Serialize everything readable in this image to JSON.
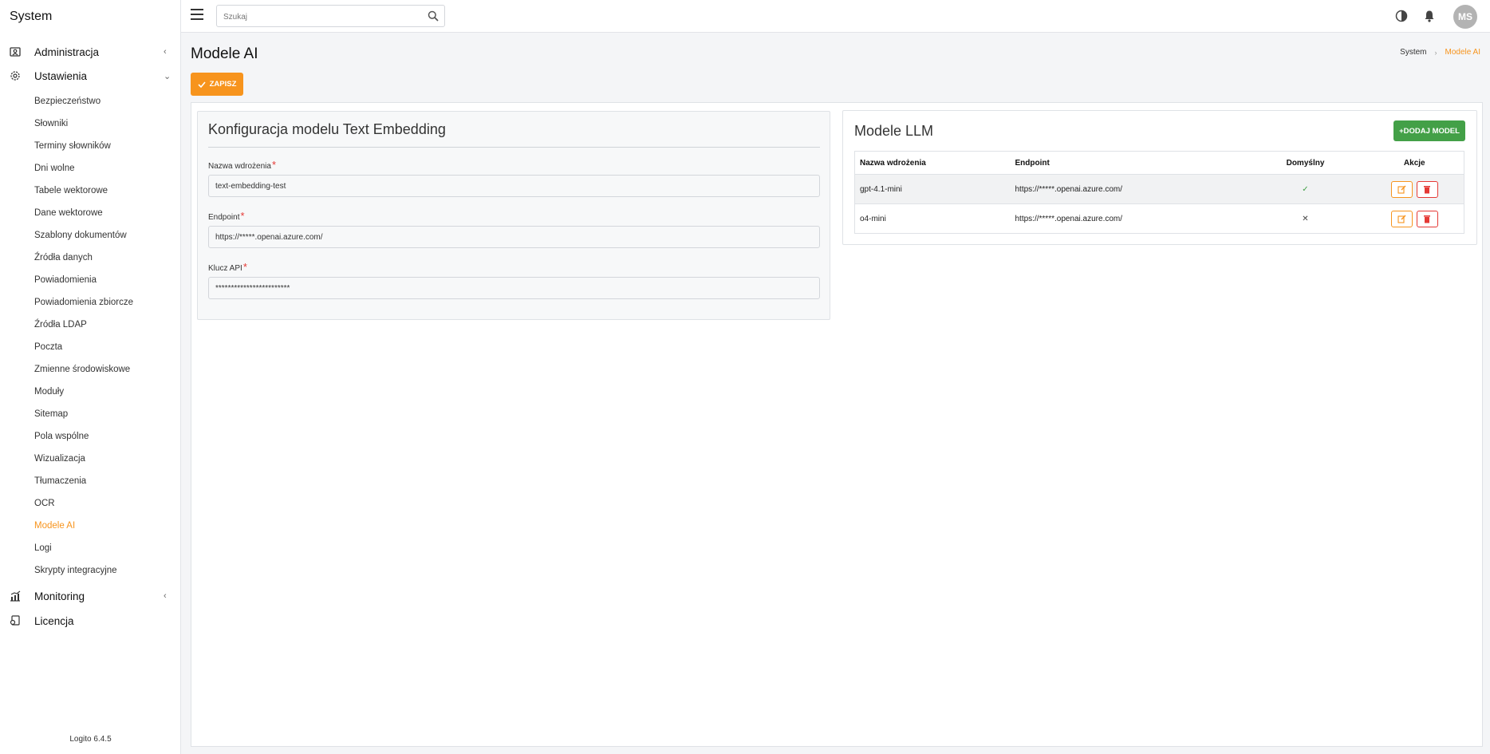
{
  "sidebar": {
    "brand": "System",
    "groups": {
      "administracja": "Administracja",
      "ustawienia": "Ustawienia",
      "monitoring": "Monitoring",
      "licencja": "Licencja"
    },
    "items": [
      "Bezpieczeństwo",
      "Słowniki",
      "Terminy słowników",
      "Dni wolne",
      "Tabele wektorowe",
      "Dane wektorowe",
      "Szablony dokumentów",
      "Źródła danych",
      "Powiadomienia",
      "Powiadomienia zbiorcze",
      "Źródła LDAP",
      "Poczta",
      "Zmienne środowiskowe",
      "Moduły",
      "Sitemap",
      "Pola wspólne",
      "Wizualizacja",
      "Tłumaczenia",
      "OCR",
      "Modele AI",
      "Logi",
      "Skrypty integracyjne"
    ],
    "active_item": "Modele AI",
    "version": "Logito 6.4.5"
  },
  "topbar": {
    "search_placeholder": "Szukaj",
    "avatar_initials": "MS"
  },
  "page": {
    "title": "Modele AI",
    "breadcrumb": [
      "System",
      "Modele AI"
    ],
    "save_label": "ZAPISZ"
  },
  "embedding": {
    "title": "Konfiguracja modelu Text Embedding",
    "fields": {
      "deployment": {
        "label": "Nazwa wdrożenia",
        "value": "text-embedding-test"
      },
      "endpoint": {
        "label": "Endpoint",
        "value": "https://*****.openai.azure.com/"
      },
      "api_key": {
        "label": "Klucz API",
        "value": "************************"
      }
    },
    "required_mark": "*"
  },
  "llm": {
    "title": "Modele LLM",
    "add_label": "DODAJ MODEL",
    "columns": [
      "Nazwa wdrożenia",
      "Endpoint",
      "Domyślny",
      "Akcje"
    ],
    "rows": [
      {
        "name": "gpt-4.1-mini",
        "endpoint": "https://*****.openai.azure.com/",
        "default": "✓"
      },
      {
        "name": "o4-mini",
        "endpoint": "https://*****.openai.azure.com/",
        "default": "✕"
      }
    ]
  },
  "colors": {
    "accent": "#f7941d",
    "success": "#43a047",
    "danger": "#e53935"
  }
}
